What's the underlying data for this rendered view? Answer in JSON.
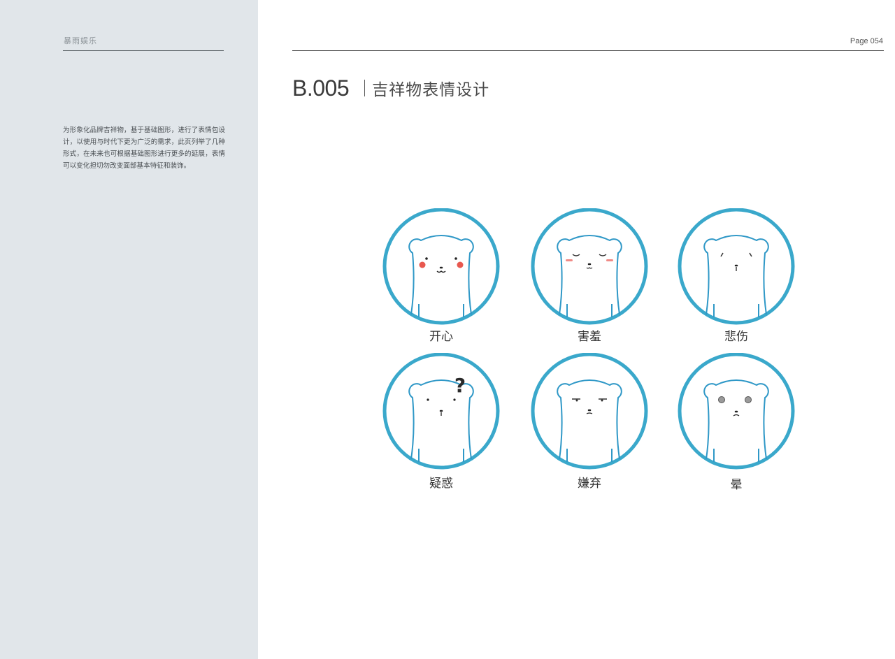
{
  "brand": "暴雨娱乐",
  "page_number": "Page 054",
  "section": {
    "code": "B.005",
    "title": "吉祥物表情设计"
  },
  "intro_text": "为形象化品牌吉祥物，基于基础图形，进行了表情包设计，以使用与时代下更为广泛的需求，此页列举了几种形式，在未来也可根据基础图形进行更多的延展，表情可以变化担切勿改变面部基本特征和装饰。",
  "colors": {
    "ring": "#3aa8cb",
    "line": "#2f98c7",
    "blush": "#e8584f",
    "sidebar": "#e1e6ea"
  },
  "expressions": [
    {
      "label": "开心",
      "icon": "happy-bear-icon"
    },
    {
      "label": "害羞",
      "icon": "shy-bear-icon"
    },
    {
      "label": "悲伤",
      "icon": "sad-bear-icon"
    },
    {
      "label": "疑惑",
      "icon": "confused-bear-icon"
    },
    {
      "label": "嫌弃",
      "icon": "disdain-bear-icon"
    },
    {
      "label": "晕",
      "icon": "dizzy-bear-icon"
    }
  ]
}
